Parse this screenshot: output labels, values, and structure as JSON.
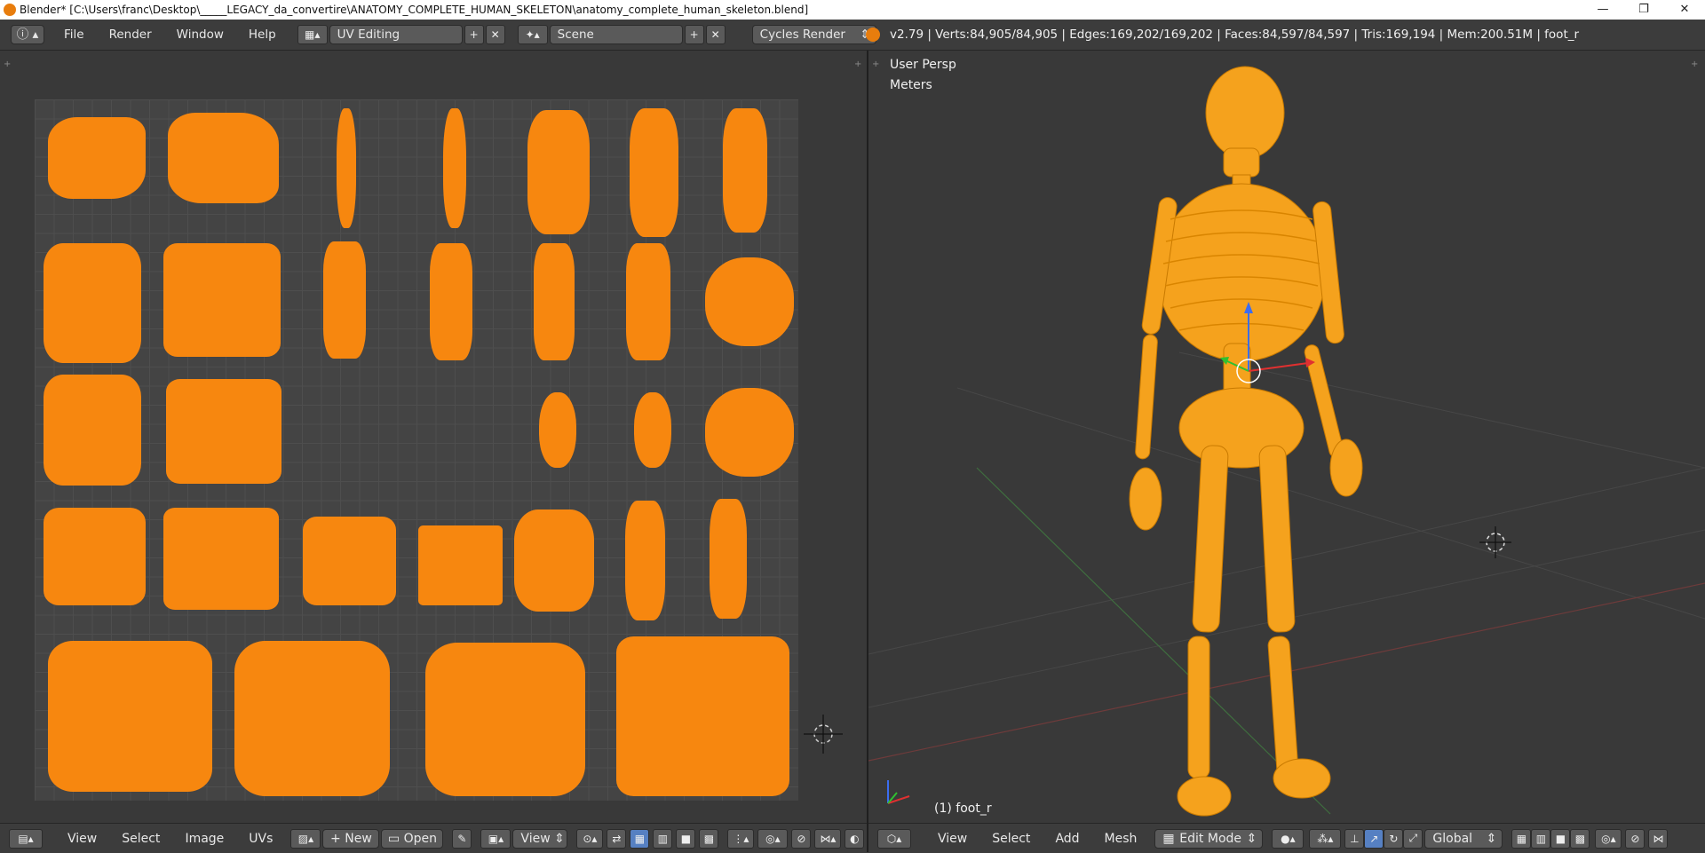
{
  "window": {
    "title": "Blender* [C:\\Users\\franc\\Desktop\\_____LEGACY_da_convertire\\ANATOMY_COMPLETE_HUMAN_SKELETON\\anatomy_complete_human_skeleton.blend]",
    "controls": [
      "—",
      "❐",
      "✕"
    ]
  },
  "infobar": {
    "menus": [
      "File",
      "Render",
      "Window",
      "Help"
    ],
    "screen_layout": "UV Editing",
    "scene": "Scene",
    "render_engine": "Cycles Render",
    "stats": "v2.79 | Verts:84,905/84,905 | Edges:169,202/169,202 | Faces:84,597/84,597 | Tris:169,194 | Mem:200.51M | foot_r"
  },
  "uv_editor": {
    "menus": [
      "View",
      "Select",
      "Image",
      "UVs"
    ],
    "new_label": "New",
    "open_label": "Open",
    "view_label": "View"
  },
  "viewport": {
    "view_label": "User Persp",
    "units_label": "Meters",
    "object_label": "(1) foot_r",
    "menus": [
      "View",
      "Select",
      "Add",
      "Mesh"
    ],
    "mode": "Edit Mode",
    "orientation": "Global"
  },
  "colors": {
    "accent_orange": "#f7870f",
    "panel_bg": "#393939",
    "header_bg": "#3c3c3c"
  }
}
